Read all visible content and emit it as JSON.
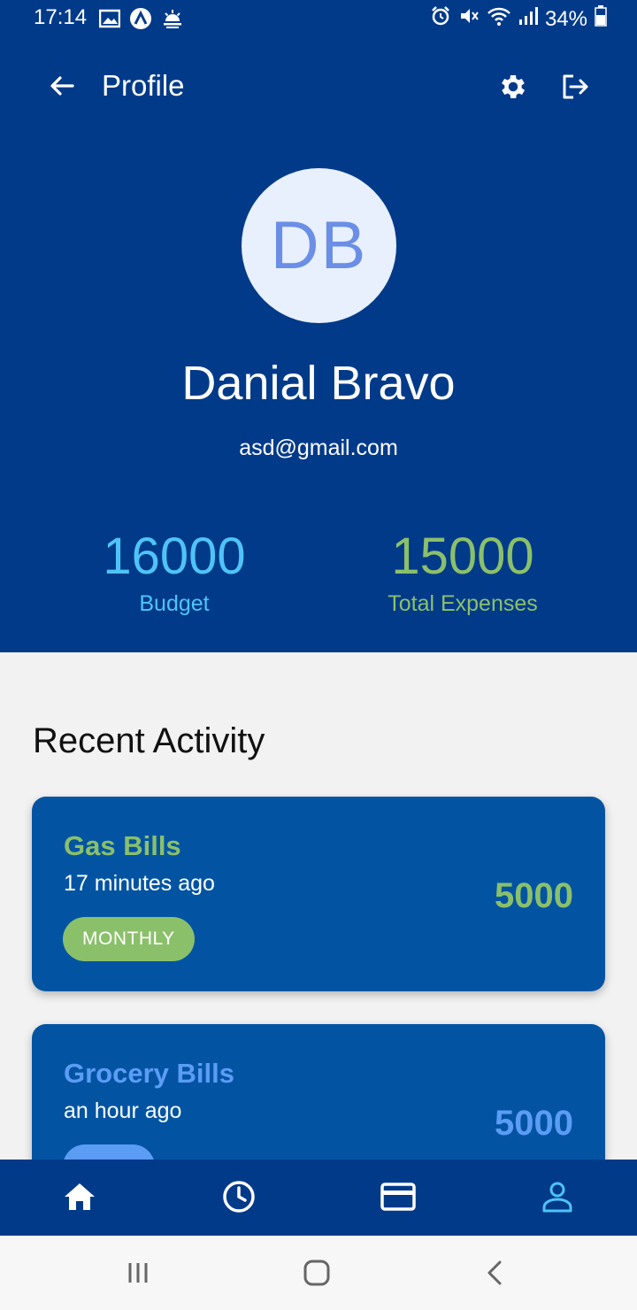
{
  "status_bar": {
    "time": "17:14",
    "battery": "34%",
    "left_icons": [
      "image-icon",
      "app-a-icon",
      "weather-icon"
    ],
    "right_icons": [
      "alarm-icon",
      "mute-icon",
      "wifi-icon",
      "signal-icon",
      "battery-icon"
    ]
  },
  "topbar": {
    "title": "Profile",
    "icons": [
      "back-arrow-icon",
      "gear-icon",
      "logout-icon"
    ]
  },
  "profile": {
    "initials": "DB",
    "name": "Danial Bravo",
    "email": "asd@gmail.com"
  },
  "stats": {
    "budget_value": "16000",
    "budget_label": "Budget",
    "expenses_value": "15000",
    "expenses_label": "Total Expenses"
  },
  "recent_activity": {
    "title": "Recent Activity",
    "items": [
      {
        "title": "Gas Bills",
        "time": "17 minutes ago",
        "amount": "5000",
        "badge": "MONTHLY",
        "accent": "#8bc06a"
      },
      {
        "title": "Grocery Bills",
        "time": "an hour ago",
        "amount": "5000",
        "badge": "",
        "accent": "#5b9cf5"
      }
    ]
  },
  "bottom_nav": {
    "items": [
      "home-icon",
      "clock-icon",
      "credit-card-icon",
      "person-icon"
    ],
    "active": "person-icon"
  },
  "colors": {
    "header_bg": "#023a8a",
    "card_bg": "#0254a3",
    "budget": "#4fc3f7",
    "expenses": "#8bc06a",
    "active_nav": "#4fc3f7"
  }
}
